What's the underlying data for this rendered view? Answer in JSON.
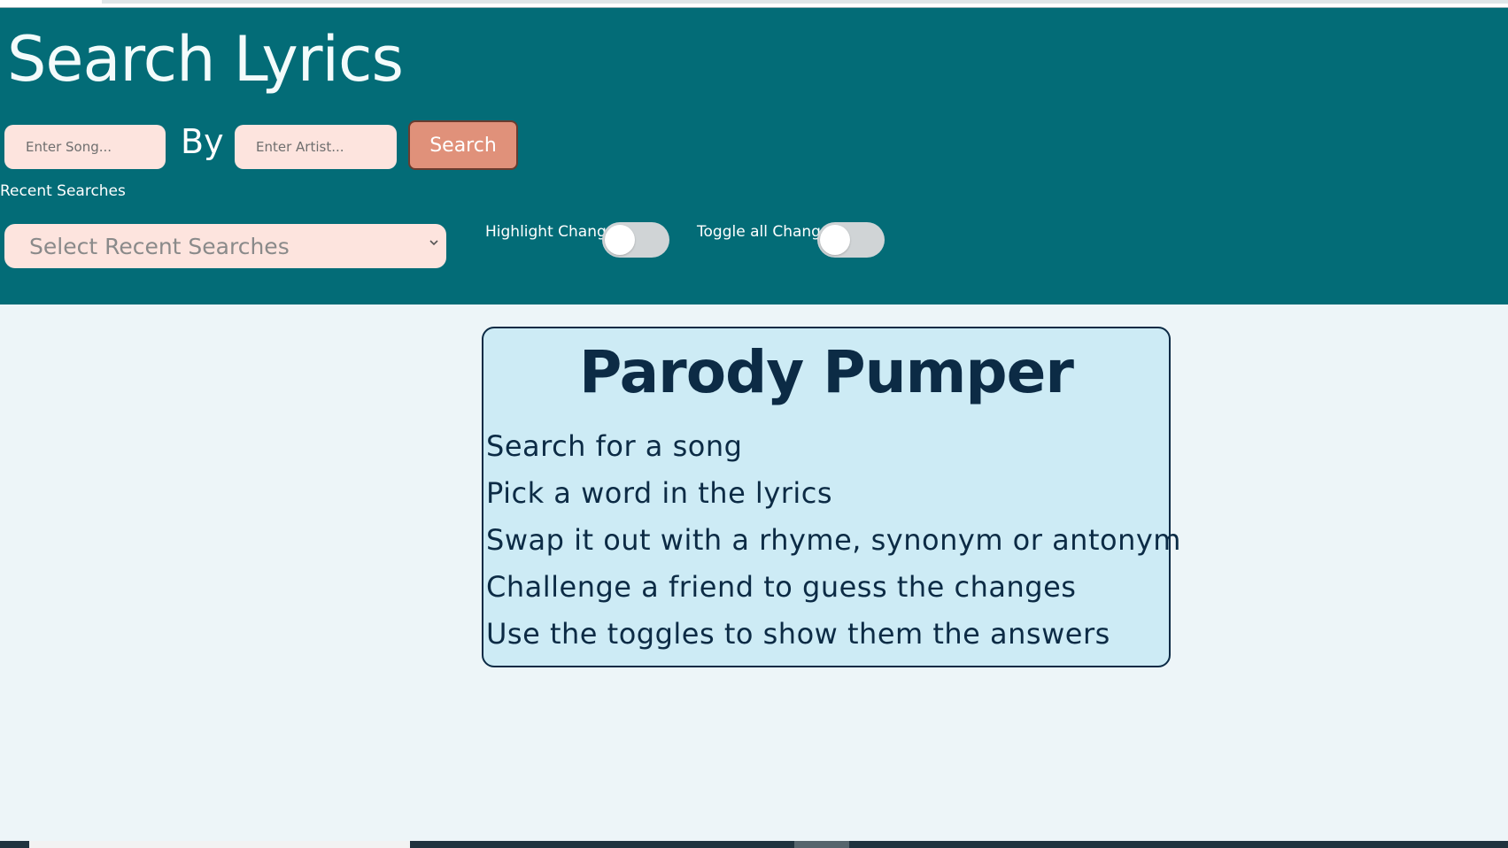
{
  "header": {
    "title": "Search Lyrics",
    "song_placeholder": "Enter Song...",
    "by_label": "By",
    "artist_placeholder": "Enter Artist...",
    "search_label": "Search",
    "recent_label": "Recent Searches",
    "recent_select_text": "Select Recent Searches",
    "highlight_label": "Highlight Changes",
    "toggle_all_label": "Toggle all Changes"
  },
  "toggles": {
    "highlight_changes": false,
    "toggle_all_changes": false
  },
  "card": {
    "title": "Parody Pumper",
    "steps": [
      "Search for a song",
      "Pick a word in the lyrics",
      "Swap it out with a rhyme, synonym or antonym",
      "Challenge a friend to guess the changes",
      "Use the toggles to show them the answers"
    ]
  },
  "colors": {
    "header_bg": "#036c77",
    "input_bg": "#fde4de",
    "search_button": "#e0917a",
    "card_bg": "#cdebf5",
    "card_text": "#0c2b45",
    "page_bg": "#edf5f8"
  },
  "icons": {
    "select_arrow": "chevron-down-icon"
  }
}
